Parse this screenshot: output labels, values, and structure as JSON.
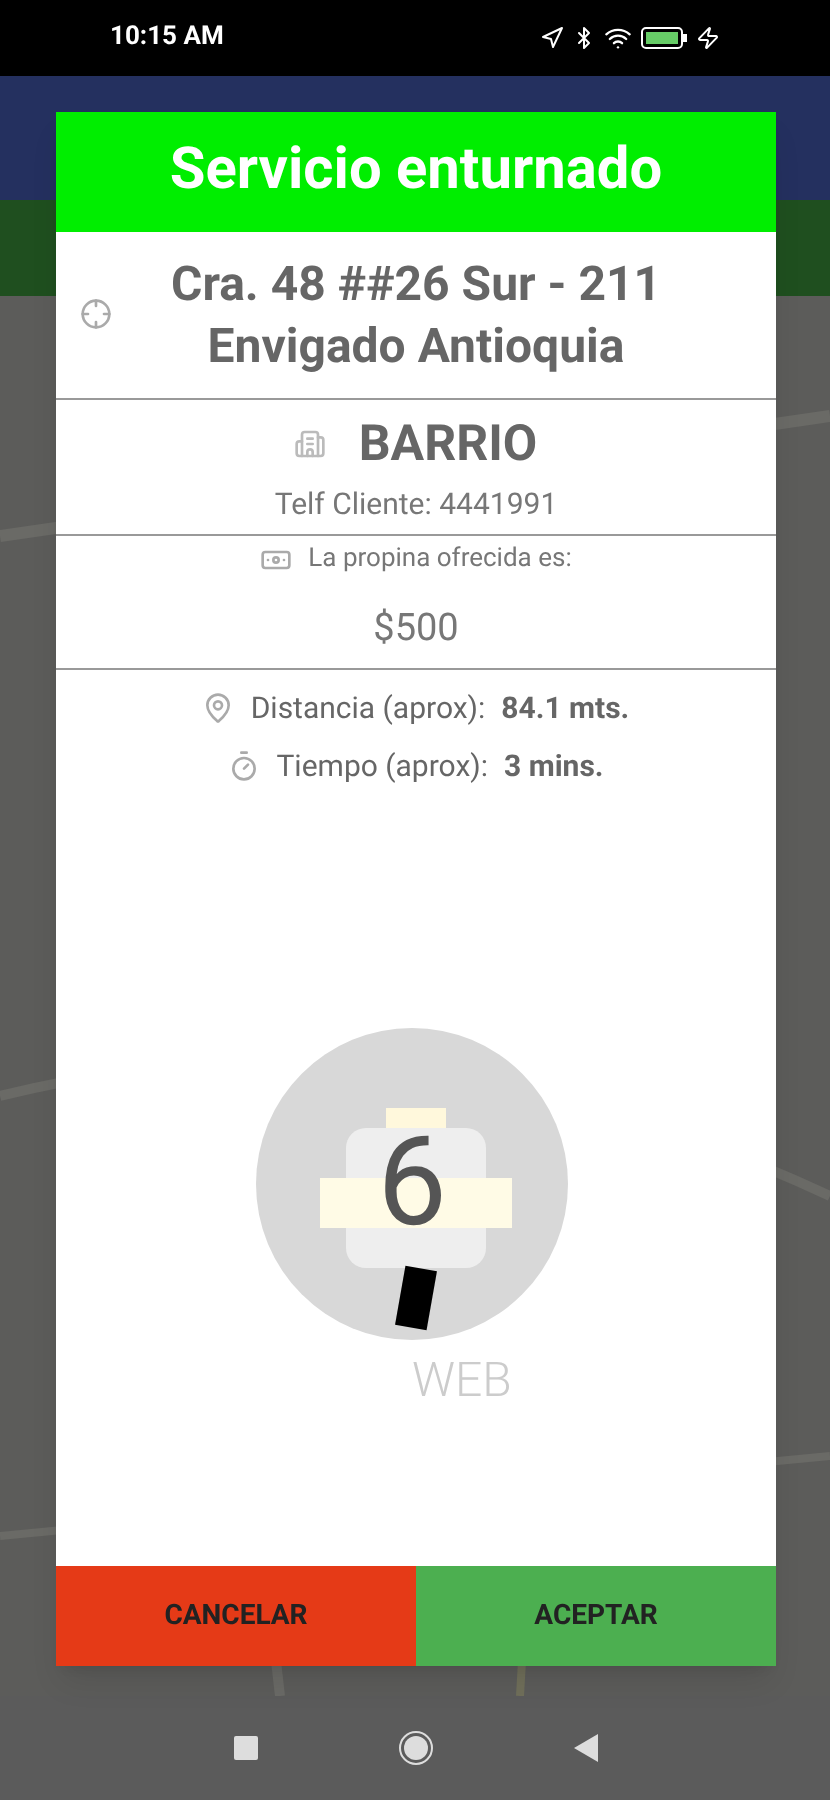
{
  "status_bar": {
    "time": "10:15 AM"
  },
  "dialog": {
    "title": "Servicio enturnado",
    "address_lines": [
      "Cra. 48 ##26 Sur - 211",
      "Envigado Antioquia"
    ],
    "neighborhood": "BARRIO",
    "phone": "Telf Cliente: 4441991",
    "tip_label": "La propina ofrecida es:",
    "tip_value": "$500",
    "stats": [
      {
        "kind": "distance",
        "label": "Distancia (aprox):",
        "value": "84.1 mts."
      },
      {
        "kind": "time",
        "label": "Tiempo (aprox):",
        "value": "3 mins."
      }
    ],
    "badge": {
      "number": "6",
      "source": "WEB"
    },
    "buttons": [
      {
        "label": "CANCELAR",
        "kind": "cancel"
      },
      {
        "label": "ACEPTAR",
        "kind": "accept"
      }
    ]
  }
}
